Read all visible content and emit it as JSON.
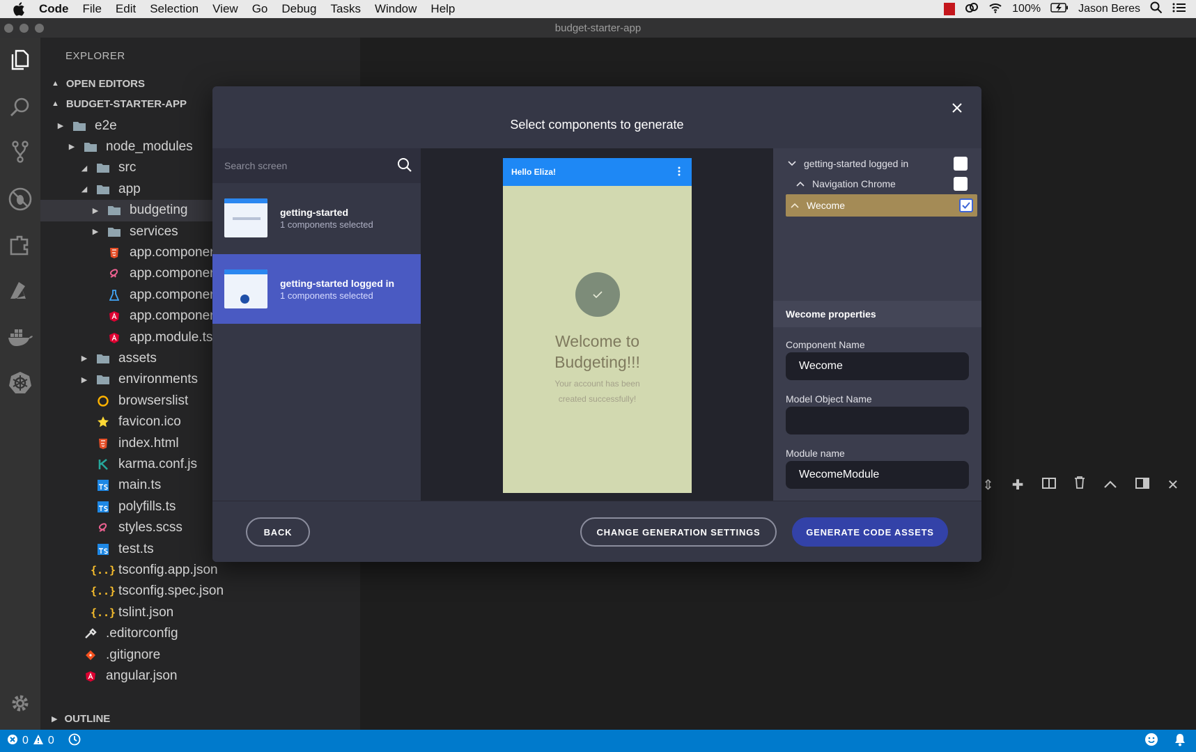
{
  "menubar": {
    "items": [
      "Code",
      "File",
      "Edit",
      "Selection",
      "View",
      "Go",
      "Debug",
      "Tasks",
      "Window",
      "Help"
    ],
    "battery": "100%",
    "user": "Jason Beres"
  },
  "window": {
    "title": "budget-starter-app"
  },
  "explorer": {
    "title": "EXPLORER",
    "open_editors": "OPEN EDITORS",
    "project": "BUDGET-STARTER-APP",
    "outline": "OUTLINE",
    "tree": [
      {
        "label": "e2e",
        "icon": "folder-icon"
      },
      {
        "label": "node_modules",
        "icon": "folder-icon"
      },
      {
        "label": "src",
        "icon": "folder-icon"
      },
      {
        "label": "app",
        "icon": "folder-icon"
      },
      {
        "label": "budgeting",
        "icon": "folder-icon"
      },
      {
        "label": "services",
        "icon": "folder-icon"
      },
      {
        "label": "app.componer",
        "icon": "html-file-icon"
      },
      {
        "label": "app.componer",
        "icon": "scss-file-icon"
      },
      {
        "label": "app.componer",
        "icon": "test-file-icon"
      },
      {
        "label": "app.componer",
        "icon": "angular-file-icon"
      },
      {
        "label": "app.module.ts",
        "icon": "angular-file-icon"
      },
      {
        "label": "assets",
        "icon": "folder-icon"
      },
      {
        "label": "environments",
        "icon": "folder-icon"
      },
      {
        "label": "browserslist",
        "icon": "browserslist-icon"
      },
      {
        "label": "favicon.ico",
        "icon": "star-icon"
      },
      {
        "label": "index.html",
        "icon": "html-file-icon"
      },
      {
        "label": "karma.conf.js",
        "icon": "karma-icon"
      },
      {
        "label": "main.ts",
        "icon": "ts-file-icon"
      },
      {
        "label": "polyfills.ts",
        "icon": "ts-file-icon"
      },
      {
        "label": "styles.scss",
        "icon": "scss-file-icon"
      },
      {
        "label": "test.ts",
        "icon": "ts-file-icon"
      },
      {
        "label": "tsconfig.app.json",
        "icon": "json-file-icon"
      },
      {
        "label": "tsconfig.spec.json",
        "icon": "json-file-icon"
      },
      {
        "label": "tslint.json",
        "icon": "json-file-icon"
      },
      {
        "label": ".editorconfig",
        "icon": "editorconfig-icon"
      },
      {
        "label": ".gitignore",
        "icon": "git-icon"
      },
      {
        "label": "angular.json",
        "icon": "angular-file-icon"
      }
    ]
  },
  "status": {
    "errors": "0",
    "warnings": "0"
  },
  "modal": {
    "title": "Select components to generate",
    "search_placeholder": "Search screen",
    "screens": [
      {
        "name": "getting-started",
        "sub": "1 components selected"
      },
      {
        "name": "getting-started logged in",
        "sub": "1 components selected"
      }
    ],
    "preview": {
      "header": "Hello Eliza!",
      "heading_line1": "Welcome to",
      "heading_line2": "Budgeting!!!",
      "body_line1": "Your account has been",
      "body_line2": "created successfully!"
    },
    "components": [
      {
        "label": "getting-started logged in",
        "checked": false
      },
      {
        "label": "Navigation Chrome",
        "checked": false
      },
      {
        "label": "Wecome",
        "checked": true
      }
    ],
    "properties": {
      "header": "Wecome properties",
      "component_name_label": "Component Name",
      "component_name_value": "Wecome",
      "model_object_label": "Model Object Name",
      "model_object_value": "",
      "module_name_label": "Module name",
      "module_name_value": "WecomeModule"
    },
    "buttons": {
      "back": "BACK",
      "change_settings": "CHANGE GENERATION SETTINGS",
      "generate": "GENERATE CODE ASSETS"
    }
  },
  "colors": {
    "accent": "#4a5ac2",
    "primary_button": "#3342a8",
    "highlight": "#a48b56",
    "statusbar": "#007acc"
  }
}
